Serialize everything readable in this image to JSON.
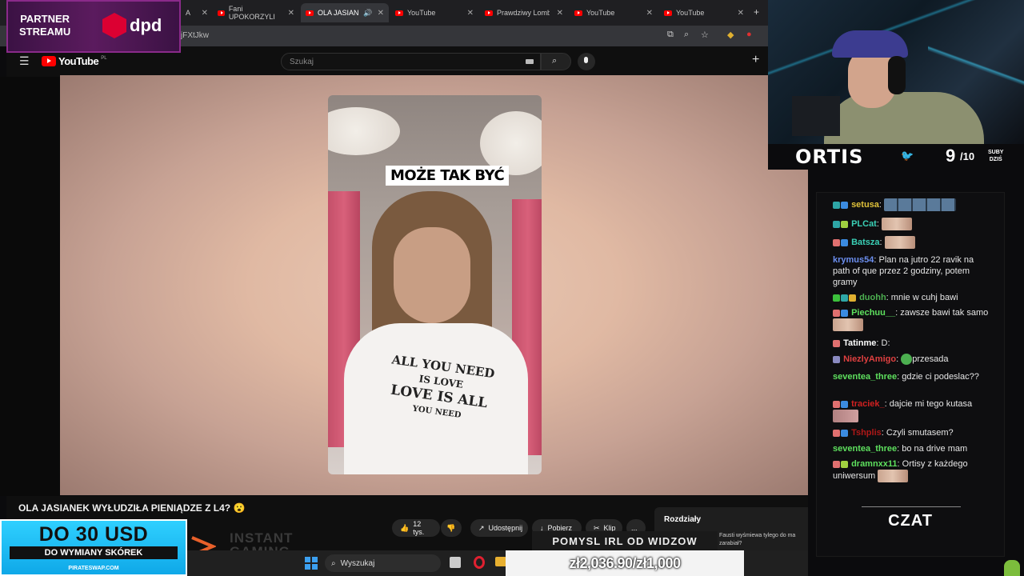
{
  "browser": {
    "tabs": [
      {
        "label": "A"
      },
      {
        "label": "Fani UPOKORZYLI"
      },
      {
        "label": "OLA JASIANEK",
        "active": true
      },
      {
        "label": "YouTube"
      },
      {
        "label": "Prawdziwy Lombard"
      },
      {
        "label": "YouTube"
      },
      {
        "label": "YouTube"
      }
    ],
    "url_fragment": "jFXtJkw"
  },
  "youtube": {
    "logo": "YouTube",
    "region": "PL",
    "search_placeholder": "Szukaj",
    "video_caption": "MOŻE TAK BYĆ",
    "shirt_text": [
      "ALL YOU NEED",
      "IS LOVE",
      "LOVE IS ALL",
      "YOU NEED"
    ],
    "video_title": "OLA JASIANEK WYŁUDZIŁA PIENIĄDZE Z L4? 😮",
    "likes": "12 tys.",
    "share_label": "Udostępnij",
    "download_label": "Pobierz",
    "clip_label": "Klip",
    "more_label": "...",
    "chapters_label": "Rozdziały",
    "chapter_snippet": "Fausti wyśmiewa tylego do ma zarabiał?"
  },
  "overlay": {
    "partner_line1": "PARTNER",
    "partner_line2": "STREAMU",
    "partner_brand": "dpd",
    "streamer": "ORTIS",
    "sub_count": "9",
    "sub_goal": "/10",
    "sub_label1": "SUBY",
    "sub_label2": "DZIŚ",
    "promo_big": "DO 30 USD",
    "promo_small": "DO WYMIANY SKÓREK",
    "promo_site": "PIRATESWAP.COM",
    "instant_gaming_line1": "INSTANT",
    "instant_gaming_line2": "GAMING",
    "idea_label": "POMYSL IRL OD WIDZOW",
    "progress_text": "zł2,036.90/zł1,000",
    "progress_fraction": 1.0,
    "chat_label": "CZAT"
  },
  "taskbar": {
    "search_label": "Wyszukaj"
  },
  "chat": {
    "messages": [
      {
        "user": "setusa",
        "color": "#e0c23a",
        "text": "",
        "emotes": 5
      },
      {
        "user": "PLCat",
        "color": "#3ad0b6",
        "text": "",
        "emotes": 1
      },
      {
        "user": "Batsza",
        "color": "#3ad0b6",
        "text": "",
        "emotes": 1
      },
      {
        "user": "krymus54",
        "color": "#6c8ff0",
        "text": "Plan na jutro 22 ravik na path of que przez 2 godziny, potem gramy",
        "emotes": 0
      },
      {
        "user": "duohh",
        "color": "#4caf50",
        "text": "mnie w cuhj bawi",
        "emotes": 0
      },
      {
        "user": "Piechuu__",
        "color": "#5ee05e",
        "text": "zawsze bawi tak samo",
        "emotes": 1
      },
      {
        "user": "Tatinme",
        "color": "#ffffff",
        "text": "D:",
        "emotes": 0
      },
      {
        "user": "NiezlyAmigo",
        "color": "#e04040",
        "text": "przesada",
        "emotes": 0
      },
      {
        "user": "seventea_three",
        "color": "#5ee05e",
        "text": "gdzie ci podeslac??",
        "emotes": 0
      },
      {
        "user": "traciek_",
        "color": "#d02020",
        "text": "dajcie mi tego kutasa",
        "emotes": 1
      },
      {
        "user": "Tshplis",
        "color": "#b01818",
        "text": "Czyli smutasem?",
        "emotes": 0
      },
      {
        "user": "seventea_three",
        "color": "#5ee05e",
        "text": "bo na drive mam",
        "emotes": 0
      },
      {
        "user": "dramnxx11",
        "color": "#5ee05e",
        "text": "Ortisy z każdego uniwersum",
        "emotes": 1
      }
    ]
  },
  "colors": {
    "yt_red": "#ff0000",
    "dpd_red": "#dc0032",
    "promo_blue": "#1ab6f0"
  }
}
